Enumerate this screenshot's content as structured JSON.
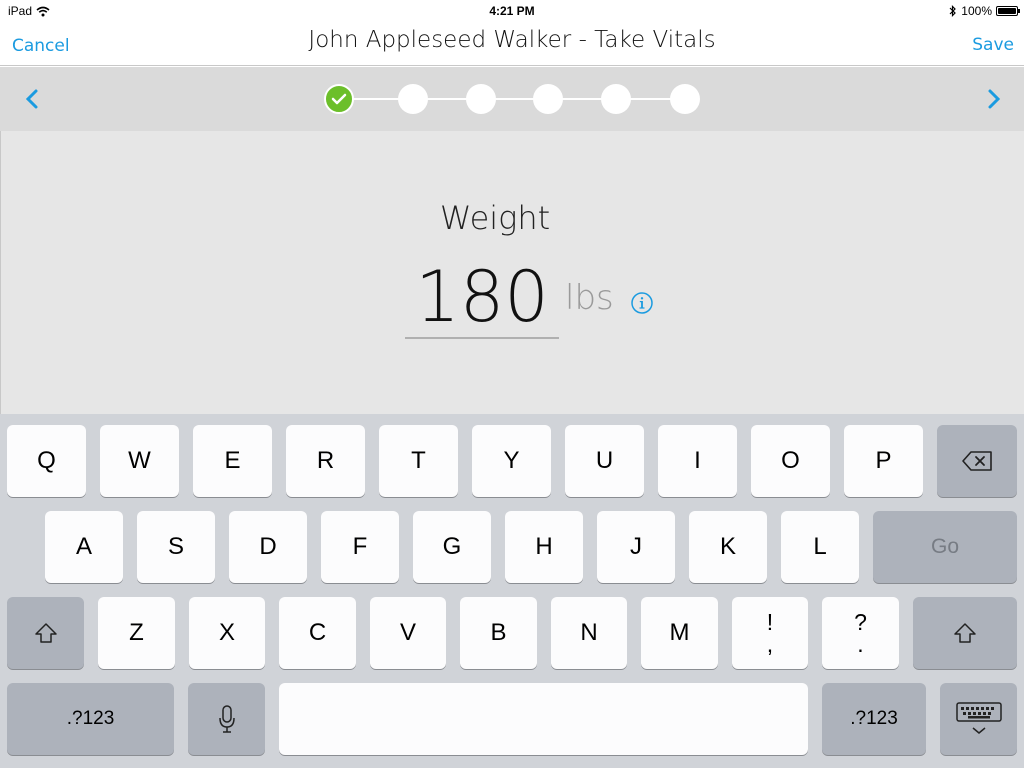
{
  "status_bar": {
    "device": "iPad",
    "time": "4:21 PM",
    "battery": "100%"
  },
  "nav": {
    "cancel": "Cancel",
    "title": "John Appleseed Walker - Take Vitals",
    "save": "Save"
  },
  "progress": {
    "current_step": 1,
    "total_steps": 6
  },
  "field": {
    "label": "Weight",
    "value": "180",
    "unit": "lbs"
  },
  "keyboard": {
    "row1": [
      "Q",
      "W",
      "E",
      "R",
      "T",
      "Y",
      "U",
      "I",
      "O",
      "P"
    ],
    "row2": [
      "A",
      "S",
      "D",
      "F",
      "G",
      "H",
      "J",
      "K",
      "L"
    ],
    "row3": [
      "Z",
      "X",
      "C",
      "V",
      "B",
      "N",
      "M"
    ],
    "go": "Go",
    "exclaim_top": "!",
    "exclaim_bottom": ",",
    "question_top": "?",
    "question_bottom": ".",
    "numbers_left": ".?123",
    "numbers_right": ".?123"
  },
  "colors": {
    "accent": "#1b9be0",
    "step_done": "#6cbf2a"
  },
  "icons": {
    "wifi": "wifi-icon",
    "bluetooth": "bluetooth-icon",
    "back": "chevron-left-icon",
    "forward": "chevron-right-icon",
    "info": "info-icon",
    "delete": "backspace-icon",
    "shift": "shift-icon",
    "mic": "microphone-icon",
    "hide_keyboard": "keyboard-dismiss-icon"
  }
}
